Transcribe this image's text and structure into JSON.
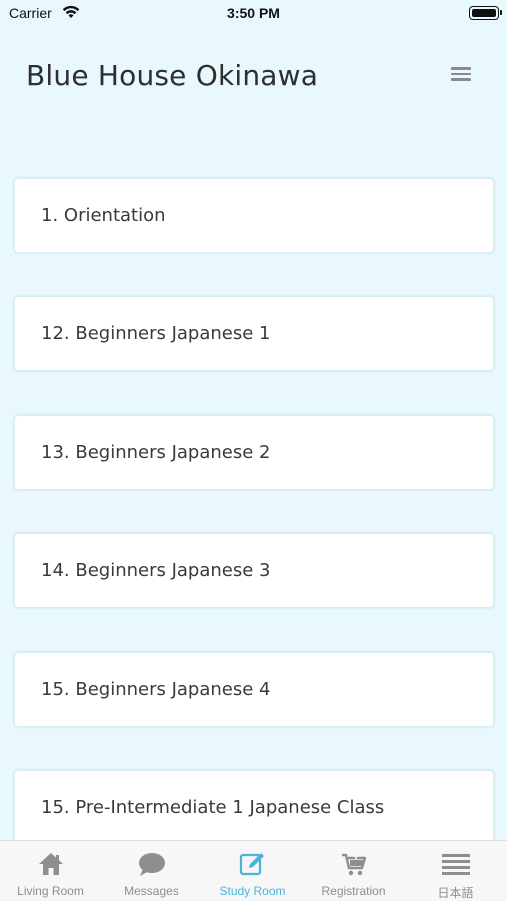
{
  "status": {
    "carrier": "Carrier",
    "time": "3:50 PM"
  },
  "header": {
    "title": "Blue House Okinawa",
    "menu_icon": "hamburger-menu-icon"
  },
  "courses": [
    {
      "label": "1. Orientation"
    },
    {
      "label": "12. Beginners Japanese 1"
    },
    {
      "label": "13. Beginners Japanese 2"
    },
    {
      "label": "14. Beginners Japanese 3"
    },
    {
      "label": "15. Beginners Japanese 4"
    },
    {
      "label": "15. Pre-Intermediate 1 Japanese Class"
    }
  ],
  "tabs": [
    {
      "label": "Living Room",
      "icon": "house-icon"
    },
    {
      "label": "Messages",
      "icon": "chat-bubble-icon"
    },
    {
      "label": "Study Room",
      "icon": "edit-icon",
      "active": true
    },
    {
      "label": "Registration",
      "icon": "cart-icon"
    },
    {
      "label": "日本語",
      "icon": "list-icon"
    }
  ],
  "colors": {
    "background": "#e8f8fd",
    "accent": "#4fb3d9",
    "inactive": "#8e8e8e"
  }
}
